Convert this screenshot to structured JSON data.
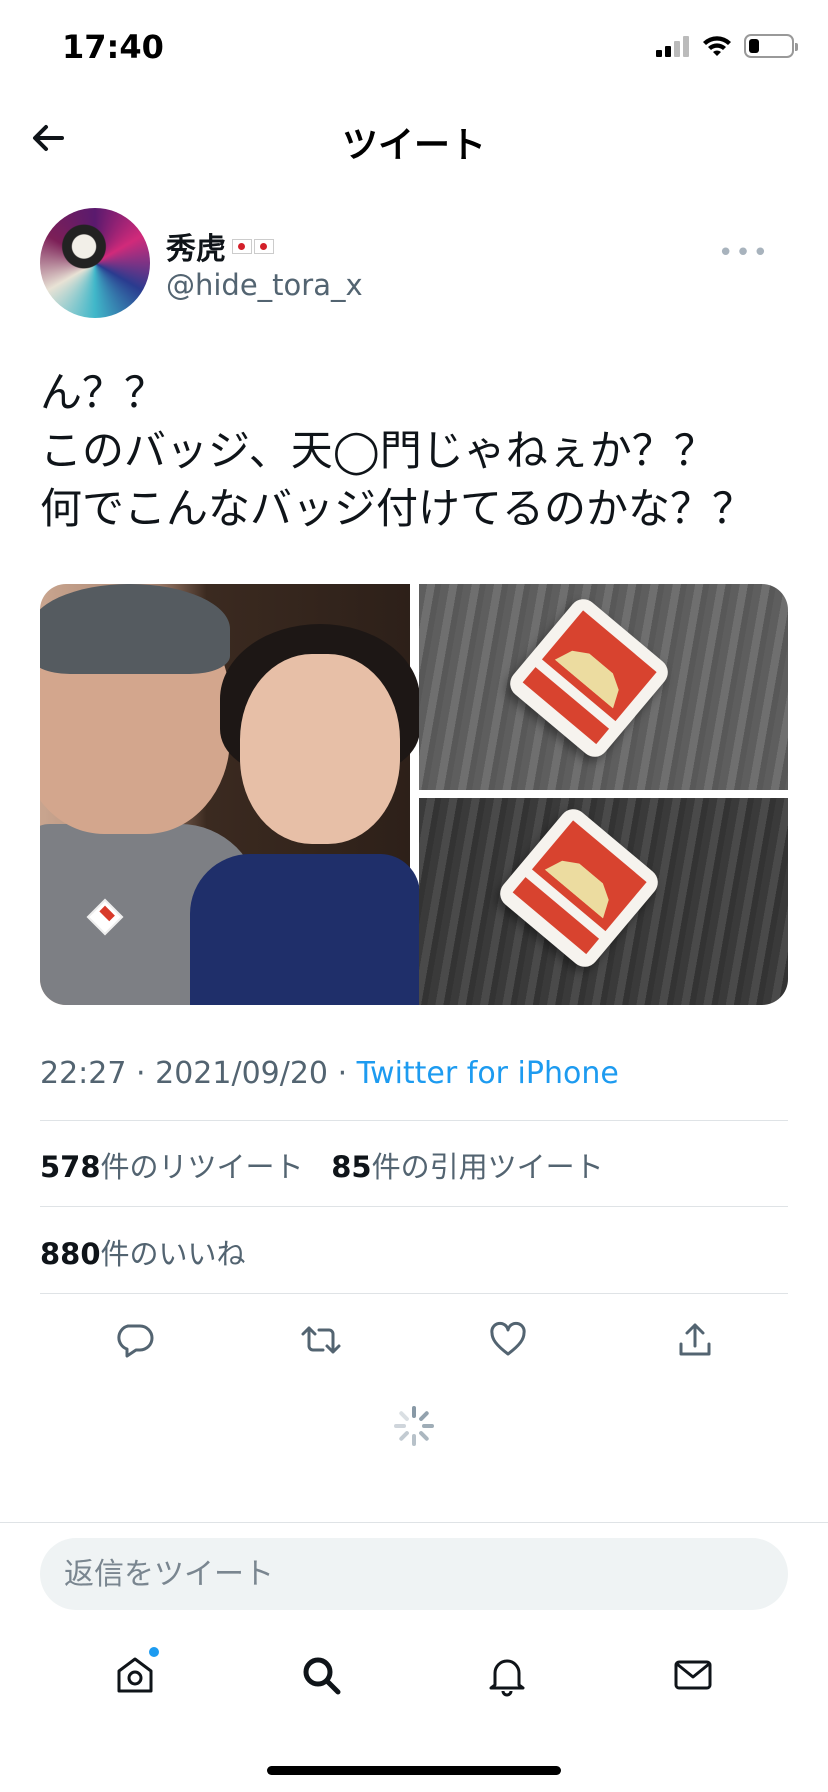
{
  "status_bar": {
    "time": "17:40",
    "battery_level": 0.25
  },
  "header": {
    "title": "ツイート",
    "back_icon": "arrow-left-icon"
  },
  "author": {
    "display_name": "秀虎",
    "handle": "@hide_tora_x",
    "more_icon": "more-dots-icon",
    "more_label": "•••"
  },
  "tweet": {
    "lines": [
      "ん？？",
      "このバッジ、天◯門じゃねぇか？？",
      "何でこんなバッジ付けてるのかな？？"
    ]
  },
  "meta": {
    "time": "22:27",
    "separator": "·",
    "date": "2021/09/20",
    "source": "Twitter for iPhone"
  },
  "stats": {
    "retweets_count": "578",
    "retweets_label": "件のリツイート",
    "quotes_count": "85",
    "quotes_label": "件の引用ツイート",
    "likes_count": "880",
    "likes_label": "件のいいね"
  },
  "actions": [
    "reply-icon",
    "retweet-icon",
    "like-icon",
    "share-icon"
  ],
  "reply": {
    "placeholder": "返信をツイート"
  },
  "tabbar": [
    "home-icon",
    "search-icon",
    "notifications-icon",
    "messages-icon"
  ],
  "colors": {
    "accent": "#1d9bf0",
    "text": "#0f1419",
    "secondary": "#536471"
  }
}
